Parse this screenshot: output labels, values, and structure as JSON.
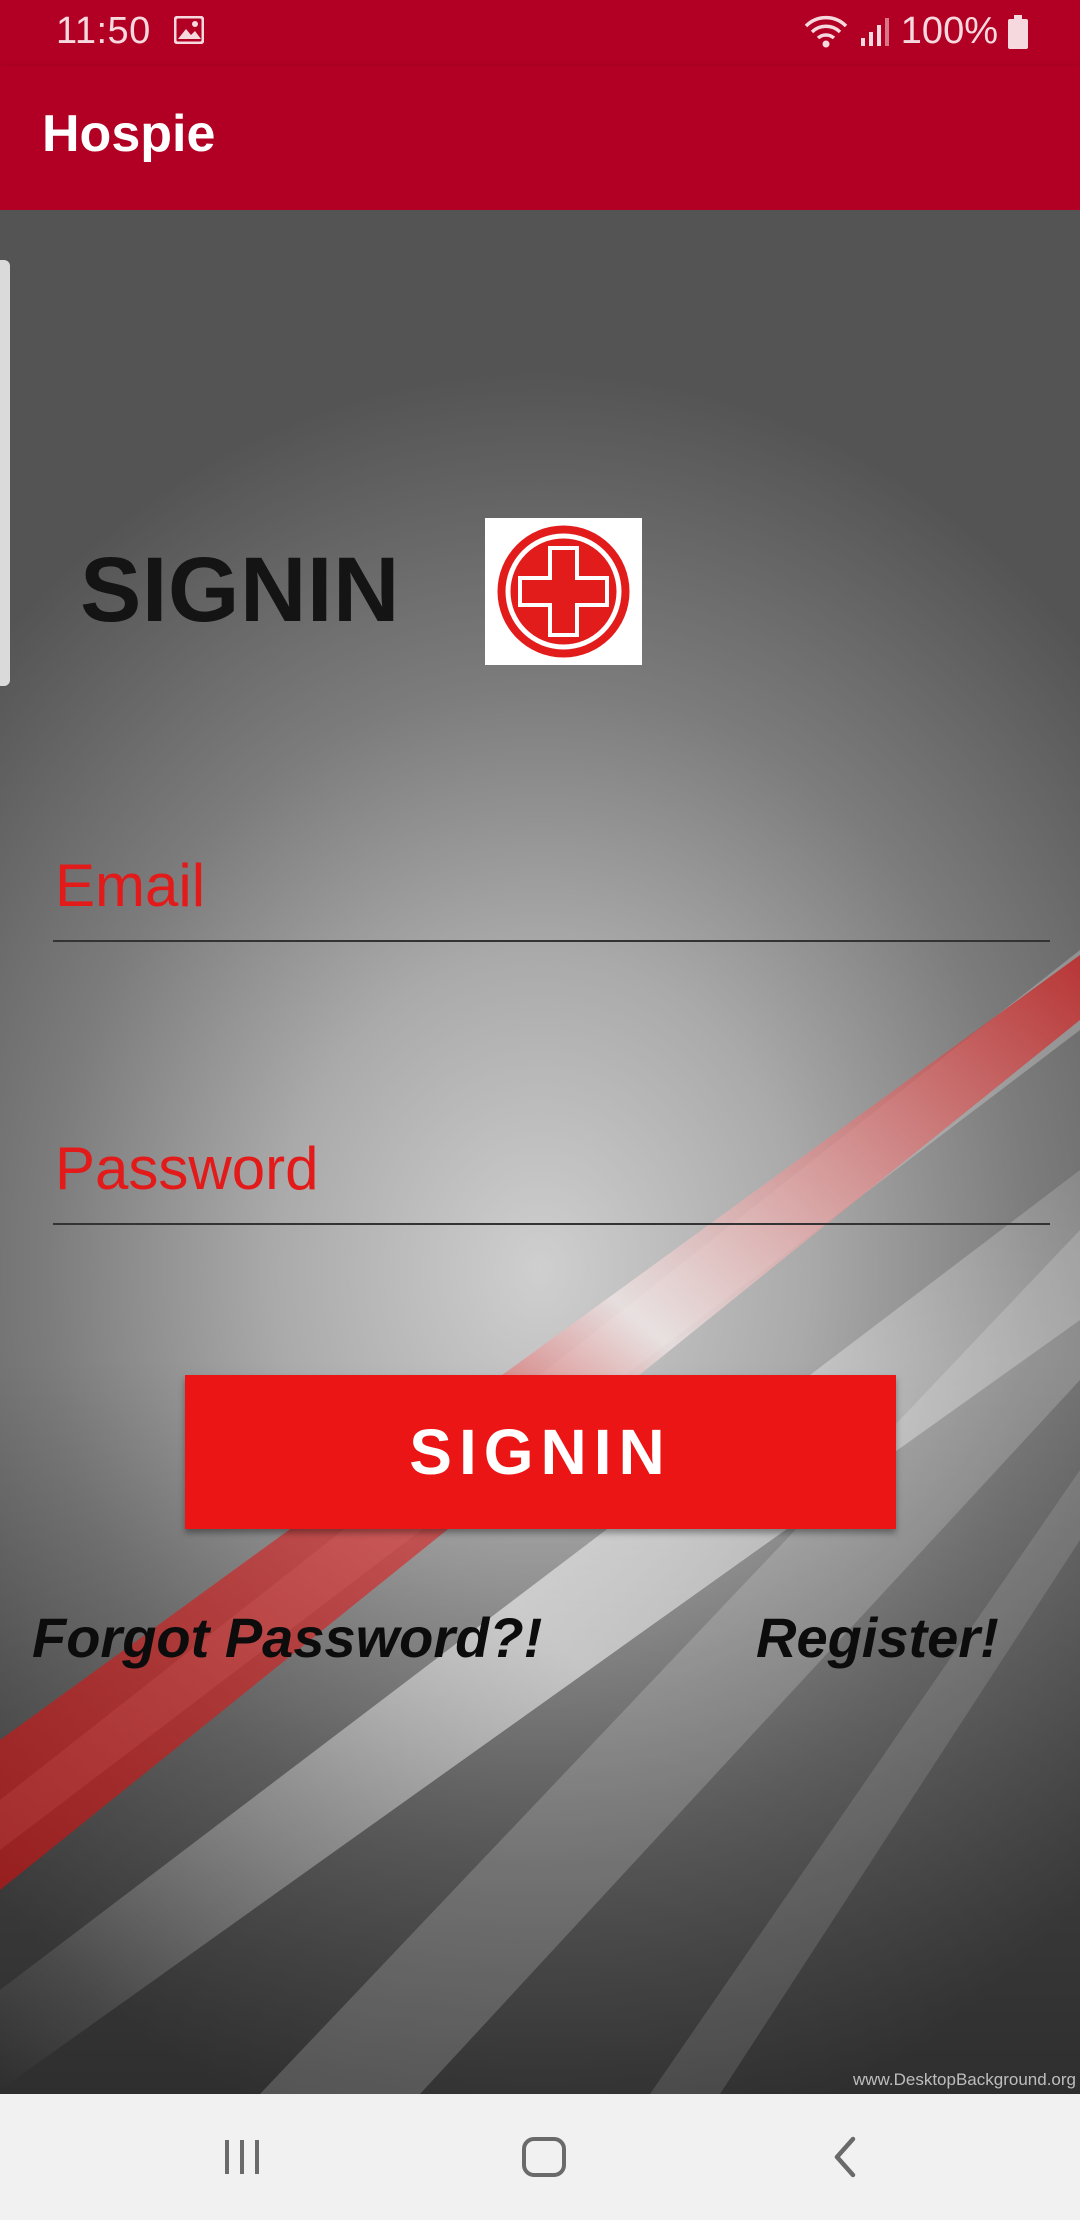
{
  "status_bar": {
    "time": "11:50",
    "battery": "100%"
  },
  "app_bar": {
    "title": "Hospie"
  },
  "signin_heading": "SIGNIN",
  "form": {
    "email_placeholder": "Email",
    "password_placeholder": "Password",
    "signin_label": "SIGNIN"
  },
  "links": {
    "forgot": "Forgot Password?!",
    "register": "Register!"
  },
  "watermark": "www.DesktopBackground.org",
  "icons": {
    "gallery": "image-icon",
    "wifi": "wifi-icon",
    "signal": "signal-icon",
    "battery": "battery-icon",
    "logo": "red-cross-icon",
    "recents": "recents-icon",
    "home": "home-icon",
    "back": "back-icon"
  },
  "colors": {
    "brand": "#b10023",
    "accent": "#ec1515",
    "hint_text": "#e21a1a",
    "nav_bar": "#f1f1f1"
  }
}
